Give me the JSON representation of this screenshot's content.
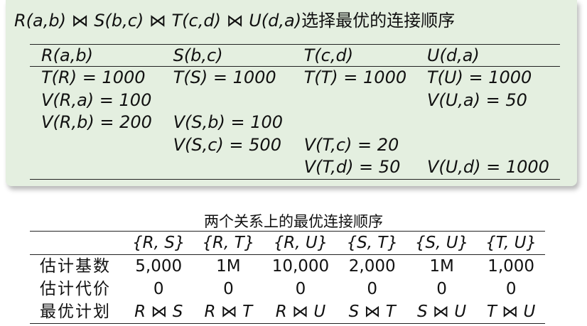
{
  "block": {
    "title_expr": "R(a,b) ⋈ S(b,c) ⋈ T(c,d) ⋈ U(d,a)",
    "title_suffix": "选择最优的连接顺序",
    "headers": [
      "R(a,b)",
      "S(b,c)",
      "T(c,d)",
      "U(d,a)"
    ],
    "rows": [
      [
        "T(R) = 1000",
        "T(S) = 1000",
        "T(T) = 1000",
        "T(U) = 1000"
      ],
      [
        "V(R,a) = 100",
        "",
        "",
        "V(U,a) = 50"
      ],
      [
        "V(R,b) = 200",
        "V(S,b) = 100",
        "",
        ""
      ],
      [
        "",
        "V(S,c) = 500",
        "V(T,c) = 20",
        ""
      ],
      [
        "",
        "",
        "V(T,d) = 50",
        "V(U,d) = 1000"
      ]
    ]
  },
  "optimal": {
    "caption": "两个关系上的最优连接顺序",
    "columns": [
      "{R, S}",
      "{R, T}",
      "{R, U}",
      "{S, T}",
      "{S, U}",
      "{T, U}"
    ],
    "rows": [
      {
        "label": "估计基数",
        "values": [
          "5,000",
          "1M",
          "10,000",
          "2,000",
          "1M",
          "1,000"
        ],
        "italic": false
      },
      {
        "label": "估计代价",
        "values": [
          "0",
          "0",
          "0",
          "0",
          "0",
          "0"
        ],
        "italic": false
      },
      {
        "label": "最优计划",
        "values": [
          "R ⋈ S",
          "R ⋈ T",
          "R ⋈ U",
          "S ⋈ T",
          "S ⋈ U",
          "T ⋈ U"
        ],
        "italic": true
      }
    ]
  }
}
